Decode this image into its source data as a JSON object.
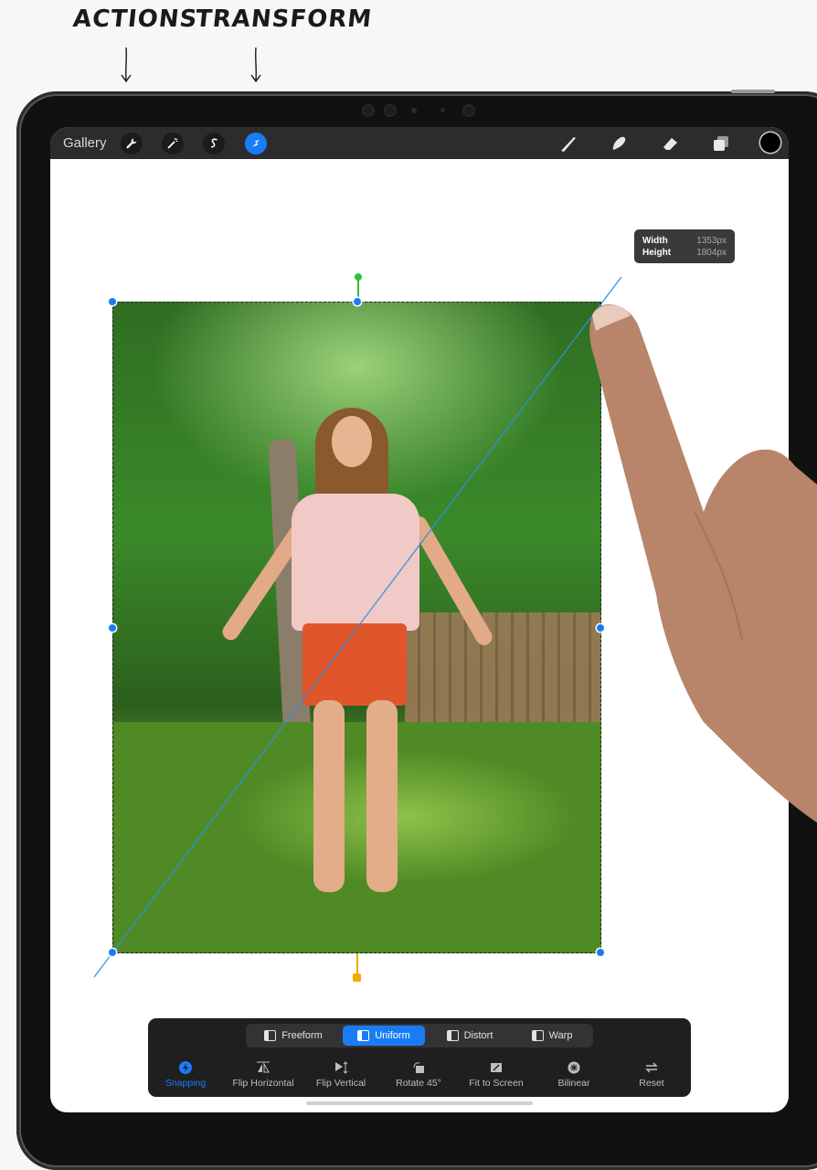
{
  "annotations": {
    "actions": "ACTIONS",
    "transform": "TRANSFORM"
  },
  "topbar": {
    "gallery_label": "Gallery",
    "left_tools": [
      "wrench-icon",
      "magic-wand-icon",
      "selection-s-icon",
      "transform-arrow-icon"
    ],
    "right_tools": [
      "brush-icon",
      "smudge-icon",
      "eraser-icon",
      "layers-icon"
    ],
    "active_tool": "transform-arrow-icon",
    "current_color": "#000000",
    "accent_color": "#1a7cf5"
  },
  "dimensions": {
    "width_label": "Width",
    "width_value": "1353px",
    "height_label": "Height",
    "height_value": "1804px"
  },
  "modes": [
    {
      "label": "Freeform",
      "active": false
    },
    {
      "label": "Uniform",
      "active": true
    },
    {
      "label": "Distort",
      "active": false
    },
    {
      "label": "Warp",
      "active": false
    }
  ],
  "actions": [
    {
      "label": "Snapping",
      "icon": "snapping-icon",
      "active": true
    },
    {
      "label": "Flip Horizontal",
      "icon": "flip-horizontal-icon",
      "active": false
    },
    {
      "label": "Flip Vertical",
      "icon": "flip-vertical-icon",
      "active": false
    },
    {
      "label": "Rotate 45°",
      "icon": "rotate-45-icon",
      "active": false
    },
    {
      "label": "Fit to Screen",
      "icon": "fit-to-screen-icon",
      "active": false
    },
    {
      "label": "Bilinear",
      "icon": "bilinear-icon",
      "active": false
    },
    {
      "label": "Reset",
      "icon": "reset-icon",
      "active": false
    }
  ]
}
